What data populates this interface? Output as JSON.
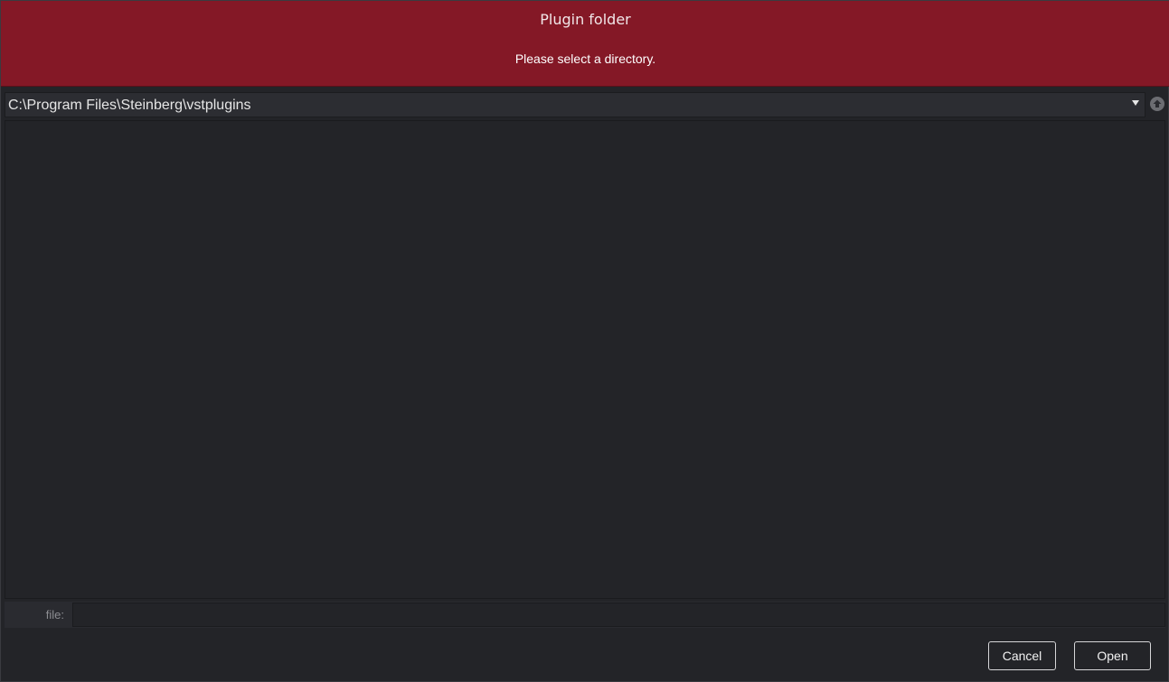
{
  "dialog": {
    "title": "Plugin folder",
    "subtitle": "Please select a directory."
  },
  "path_bar": {
    "current_path": "C:\\Program Files\\Steinberg\\vstplugins",
    "dropdown_icon": "chevron-down-icon",
    "up_icon": "folder-up-icon"
  },
  "file_list": {
    "items": []
  },
  "file_field": {
    "label": "file:",
    "value": "",
    "placeholder": ""
  },
  "buttons": {
    "cancel_label": "Cancel",
    "open_label": "Open"
  },
  "colors": {
    "header_bg": "#841826",
    "panel_bg": "#232428",
    "text": "#e6e6e6"
  }
}
